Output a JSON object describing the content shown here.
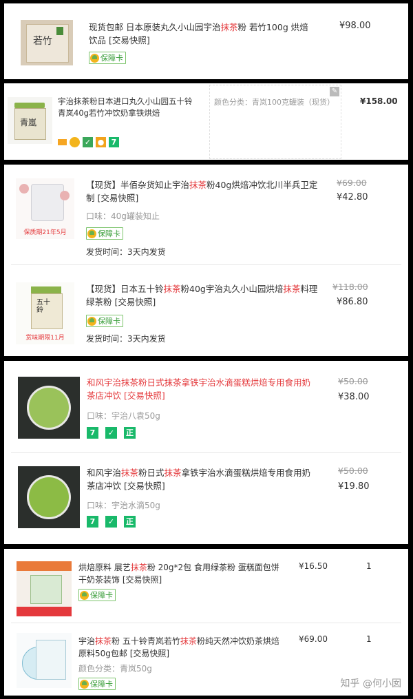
{
  "colors": {
    "highlight": "#e4393c",
    "badge_green": "#19b96a",
    "price": "#333333",
    "muted": "#999999"
  },
  "p1": {
    "title_a": "现货包邮 日本原装丸久小山园宇治",
    "title_hl": "抹茶",
    "title_b": "粉 若竹100g 烘焙 饮品 [交易快照]",
    "thumb_text": "若竹",
    "badge": "保障卡",
    "price": "¥98.00"
  },
  "p2": {
    "title": "宇治抹茶粉日本进口丸久小山园五十铃青岚40g若竹冲饮奶拿铁烘焙",
    "thumb_text": "青嵐",
    "option_label": "颜色分类：",
    "option_value": "青岚100克罐装（现货）",
    "price": "¥158.00",
    "icons": [
      "card-icon",
      "yellow-badge-icon",
      "guarantee-icon",
      "coin-icon",
      "seven-day-icon"
    ],
    "seven": "7"
  },
  "p3": {
    "items": [
      {
        "title_a": "【现货】半佰杂货知止宇治",
        "title_hl": "抹茶",
        "title_b": "粉40g烘焙冲饮北川半兵卫定制 [交易快照]",
        "taste_label": "口味：",
        "taste_value": "40g罐装知止",
        "badge": "保障卡",
        "ship": "发货时间：3天内发货",
        "old_price": "¥69.00",
        "price": "¥42.80",
        "thumb_caption": "保质期21年5月"
      },
      {
        "title_a": "【现货】日本五十铃",
        "title_hl": "抹茶",
        "title_b": "粉40g宇治丸久小山园烘焙",
        "title_hl2": "抹茶",
        "title_c": "料理绿茶粉 [交易快照]",
        "badge": "保障卡",
        "ship": "发货时间：3天内发货",
        "old_price": "¥118.00",
        "price": "¥86.80",
        "thumb_text": "五十鈴",
        "thumb_caption": "赏味期限11月"
      }
    ]
  },
  "p4": {
    "items": [
      {
        "title_a": "和风宇治",
        "title_hl": "抹茶",
        "title_b": "粉日式",
        "title_hl2": "抹茶",
        "title_c": "拿铁宇治水滴蛋糕烘焙专用食用奶茶店冲饮 [交易快照]",
        "taste_label": "口味：",
        "taste_value": "宇治八袁50g",
        "old_price": "¥50.00",
        "price": "¥38.00"
      },
      {
        "title_a": "和风宇治",
        "title_hl": "抹茶",
        "title_b": "粉日式",
        "title_hl2": "抹茶",
        "title_c": "拿铁宇治水滴蛋糕烘焙专用食用奶茶店冲饮 [交易快照]",
        "taste_label": "口味：",
        "taste_value": "宇治水滴50g",
        "old_price": "¥50.00",
        "price": "¥19.80"
      }
    ],
    "seven": "7",
    "zheng": "正"
  },
  "p5": {
    "items": [
      {
        "title_a": "烘焙原料 展艺",
        "title_hl": "抹茶",
        "title_b": "粉 20g*2包 食用绿茶粉 蛋糕面包饼干奶茶装饰 [交易快照]",
        "badge": "保障卡",
        "price": "¥16.50",
        "qty": "1"
      },
      {
        "title_a": "宇治",
        "title_hl": "抹茶",
        "title_b": "粉 五十铃青岚若竹",
        "title_hl2": "抹茶",
        "title_c": "粉纯天然冲饮奶茶烘焙原料50g包邮 [交易快照]",
        "option_label": "颜色分类：",
        "option_value": "青岚50g",
        "badge": "保障卡",
        "price": "¥69.00",
        "qty": "1"
      }
    ],
    "watermark": "知乎 @何小囡"
  }
}
